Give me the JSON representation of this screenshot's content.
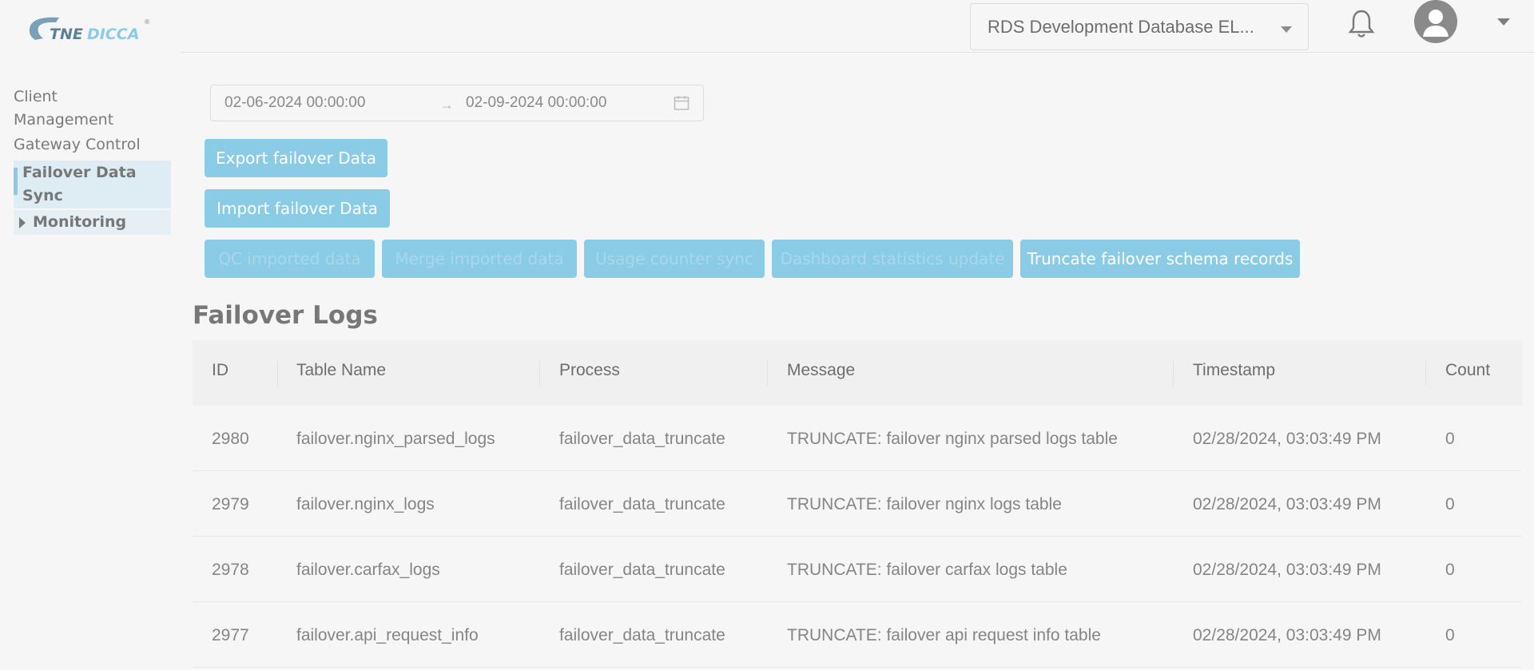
{
  "header": {
    "logo_text": "TNEDICCA",
    "db_select": {
      "value": "RDS Development Database EL..."
    },
    "icons": {
      "bell": "bell-icon",
      "avatar": "user-avatar-icon",
      "caret": "chevron-down-icon"
    }
  },
  "sidebar": {
    "items": [
      {
        "label": "Client"
      },
      {
        "label": "Management"
      },
      {
        "label": "Gateway Control"
      },
      {
        "label": "Failover Data"
      },
      {
        "label": "Sync"
      },
      {
        "label": "Monitoring"
      }
    ]
  },
  "filters": {
    "start_date": "02-06-2024 00:00:00",
    "end_date": "02-09-2024 00:00:00",
    "separator": "→"
  },
  "actions": {
    "export": "Export failover Data",
    "import": "Import failover Data",
    "qc": "QC imported data",
    "merge": "Merge imported data",
    "usage": "Usage counter sync",
    "dashboard": "Dashboard statistics update",
    "truncate": "Truncate failover schema records"
  },
  "logs": {
    "title": "Failover Logs",
    "columns": {
      "id": "ID",
      "table_name": "Table Name",
      "process": "Process",
      "message": "Message",
      "timestamp": "Timestamp",
      "count": "Count"
    },
    "rows": [
      {
        "id": "2980",
        "table_name": "failover.nginx_parsed_logs",
        "process": "failover_data_truncate",
        "message": "TRUNCATE: failover nginx parsed logs table",
        "timestamp": "02/28/2024, 03:03:49 PM",
        "count": "0"
      },
      {
        "id": "2979",
        "table_name": "failover.nginx_logs",
        "process": "failover_data_truncate",
        "message": "TRUNCATE: failover nginx logs table",
        "timestamp": "02/28/2024, 03:03:49 PM",
        "count": "0"
      },
      {
        "id": "2978",
        "table_name": "failover.carfax_logs",
        "process": "failover_data_truncate",
        "message": "TRUNCATE: failover carfax logs table",
        "timestamp": "02/28/2024, 03:03:49 PM",
        "count": "0"
      },
      {
        "id": "2977",
        "table_name": "failover.api_request_info",
        "process": "failover_data_truncate",
        "message": "TRUNCATE: failover api request info table",
        "timestamp": "02/28/2024, 03:03:49 PM",
        "count": "0"
      }
    ]
  },
  "colors": {
    "button": "#8acbe6",
    "active_nav": "#deedf4",
    "accent_bar": "#8bc8e4",
    "background": "#f6f6f6"
  }
}
